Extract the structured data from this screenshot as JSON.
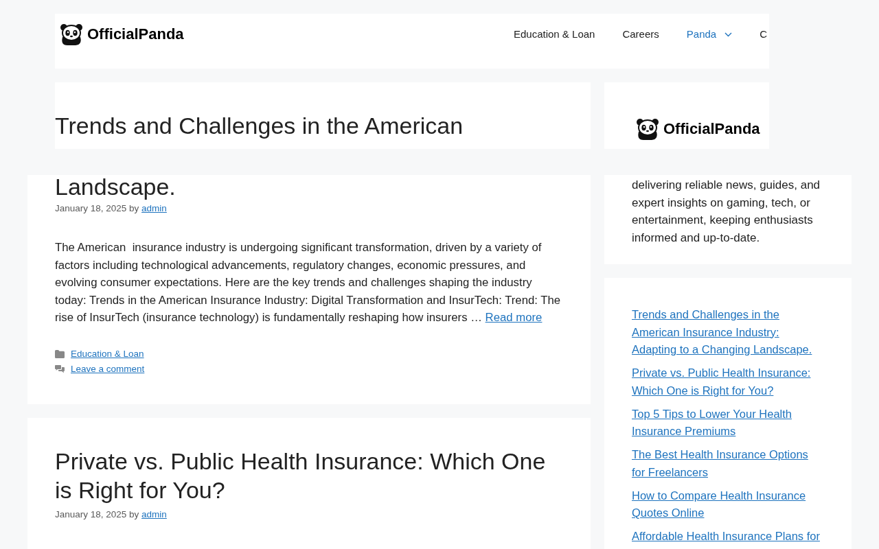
{
  "header": {
    "logo": {
      "text": "OfficialPanda"
    },
    "nav": [
      {
        "label": "Education & Loan",
        "kind": "link",
        "selected": false
      },
      {
        "label": "Careers",
        "kind": "link",
        "selected": false
      },
      {
        "label": "Panda",
        "kind": "dropdown",
        "selected": true
      },
      {
        "label": "C",
        "kind": "link",
        "selected": false
      }
    ]
  },
  "sticky_bar": {
    "post_title": "Trends and Challenges in the American",
    "sidebar_logo": {
      "text": "OfficialPanda"
    }
  },
  "posts": [
    {
      "title": "Landscape.",
      "date": "January 18, 2025",
      "byline": "by",
      "author": "admin",
      "excerpt": "The American  insurance industry is undergoing significant transformation, driven by a variety of factors including technological advancements, regulatory changes, economic pressures, and evolving consumer expectations. Here are the key trends and challenges shaping the industry today: Trends in the American Insurance Industry: Digital Transformation and InsurTech: Trend: The rise of InsurTech (insurance technology) is fundamentally reshaping how insurers …",
      "read_more": "Read more",
      "category": "Education & Loan",
      "comments": "Leave a comment"
    },
    {
      "title": "Private vs. Public Health Insurance: Which One is Right for You?",
      "date": "January 18, 2025",
      "byline": "by",
      "author": "admin"
    }
  ],
  "sidebar": {
    "about": "delivering reliable news, guides, and expert insights on gaming, tech, or entertainment, keeping enthusiasts informed and up-to-date.",
    "recent_posts": [
      "Trends and Challenges in the American Insurance Industry: Adapting to a Changing Landscape.",
      "Private vs. Public Health Insurance: Which One is Right for You?",
      "Top 5 Tips to Lower Your Health Insurance Premiums",
      "The Best Health Insurance Options for Freelancers",
      "How to Compare Health Insurance Quotes Online",
      "Affordable Health Insurance Plans for"
    ]
  }
}
